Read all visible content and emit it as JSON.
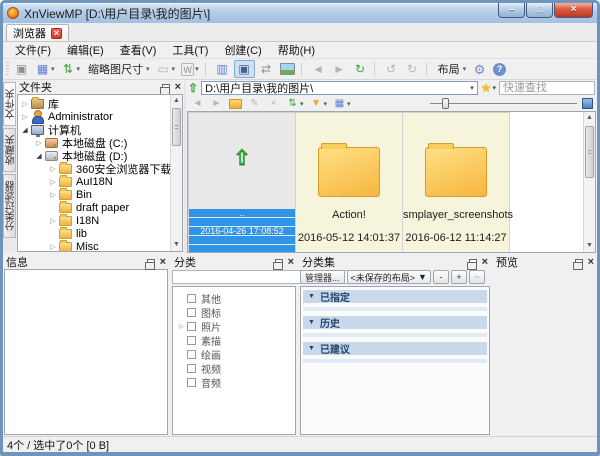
{
  "window": {
    "title": "XnViewMP [D:\\用户目录\\我的图片\\]"
  },
  "window_buttons": [
    {
      "name": "minimize-button",
      "glyph": "–",
      "cls": "wmin"
    },
    {
      "name": "maximize-button",
      "glyph": "□",
      "cls": "wmax"
    },
    {
      "name": "close-button",
      "glyph": "×",
      "cls": "wclose"
    }
  ],
  "tab": {
    "label": "浏览器",
    "close_glyph": "×"
  },
  "menu": {
    "items": [
      {
        "label": "文件(F)"
      },
      {
        "label": "编辑(E)"
      },
      {
        "label": "查看(V)"
      },
      {
        "label": "工具(T)"
      },
      {
        "label": "创建(C)"
      },
      {
        "label": "帮助(H)"
      }
    ]
  },
  "main_toolbar": {
    "items": [
      {
        "name": "viewer-button",
        "glyph": "▣",
        "cls": "c-grey"
      },
      {
        "name": "thumbnail-view-button",
        "glyph": "▦",
        "cls": "c-blue",
        "caret": "▾"
      },
      {
        "name": "sort-button",
        "glyph": "⇅",
        "cls": "c-green",
        "caret": "▾"
      },
      {
        "name": "thumbnail-size-button",
        "label": "缩略图尺寸",
        "cls": "txt",
        "caret": "▾"
      },
      {
        "name": "slideshow-button",
        "glyph": "▭",
        "cls": "c-disabled",
        "caret": "▾"
      },
      {
        "name": "web-button",
        "glyph": "W",
        "cls": "c-grey boxed",
        "caret": "▾"
      },
      {
        "name": "separator",
        "cls": "sep"
      },
      {
        "name": "compare-button",
        "glyph": "▥",
        "cls": "c-blue"
      },
      {
        "name": "capture-button",
        "glyph": "▣",
        "cls": "hl"
      },
      {
        "name": "batch-convert-button",
        "glyph": "⇄",
        "cls": "c-grey"
      },
      {
        "name": "photos-button",
        "glyph": "",
        "cls": "pic"
      },
      {
        "name": "separator",
        "cls": "sep"
      },
      {
        "name": "back-button",
        "glyph": "◄",
        "cls": "c-disabled"
      },
      {
        "name": "forward-button",
        "glyph": "►",
        "cls": "c-disabled"
      },
      {
        "name": "refresh-button",
        "glyph": "↻",
        "cls": "c-green"
      },
      {
        "name": "separator",
        "cls": "sep"
      },
      {
        "name": "rotate-left-button",
        "glyph": "↺",
        "cls": "c-disabled"
      },
      {
        "name": "rotate-right-button",
        "glyph": "↻",
        "cls": "c-disabled"
      },
      {
        "name": "separator",
        "cls": "sep"
      },
      {
        "name": "layout-button",
        "label": "布局",
        "cls": "txt",
        "caret": "▾"
      },
      {
        "name": "settings-button",
        "glyph": "⚙",
        "cls": "c-gear"
      },
      {
        "name": "help-button",
        "glyph": "?",
        "cls": "help"
      }
    ]
  },
  "side_tabs": {
    "items": [
      {
        "label": "文件夹",
        "cls": "active"
      },
      {
        "label": "收藏夹",
        "cls": ""
      },
      {
        "label": "分类过滤器",
        "cls": ""
      }
    ]
  },
  "folders_panel": {
    "title": "文件夹",
    "tree": [
      {
        "label": "库",
        "cls": "d0",
        "arrow": "▷",
        "icon": "i-lib"
      },
      {
        "label": "Administrator",
        "cls": "d0",
        "arrow": "▷",
        "icon": "i-user"
      },
      {
        "label": "计算机",
        "cls": "d0 exp",
        "arrow": "◢",
        "icon": "i-pc"
      },
      {
        "label": "本地磁盘 (C:)",
        "cls": "d1",
        "arrow": "▷",
        "icon": "i-cdrive"
      },
      {
        "label": "本地磁盘 (D:)",
        "cls": "d1 exp",
        "arrow": "◢",
        "icon": "i-drive"
      },
      {
        "label": "360安全浏览器下载",
        "cls": "d2",
        "arrow": "▷",
        "icon": "i-folder"
      },
      {
        "label": "AuI18N",
        "cls": "d2",
        "arrow": "▷",
        "icon": "i-folder"
      },
      {
        "label": "Bin",
        "cls": "d2",
        "arrow": "▷",
        "icon": "i-folder"
      },
      {
        "label": "draft paper",
        "cls": "d2",
        "arrow": "",
        "icon": "i-folder"
      },
      {
        "label": "I18N",
        "cls": "d2",
        "arrow": "▷",
        "icon": "i-folder"
      },
      {
        "label": "lib",
        "cls": "d2",
        "arrow": "",
        "icon": "i-folder"
      },
      {
        "label": "Misc",
        "cls": "d2",
        "arrow": "▷",
        "icon": "i-folder"
      }
    ]
  },
  "address": {
    "up_glyph": "⇧",
    "path": "D:\\用户目录\\我的图片\\",
    "combo_caret": "▾",
    "star_glyph": "★",
    "star_caret": "▾",
    "search_placeholder": "快速查找"
  },
  "browser_toolbar": {
    "items": [
      {
        "name": "back-button",
        "glyph": "◄",
        "cls": "c-disabled"
      },
      {
        "name": "forward-button",
        "glyph": "►",
        "cls": "c-disabled"
      },
      {
        "name": "parent-folder-button",
        "glyph": "",
        "cls": "fup"
      },
      {
        "name": "edit-button",
        "glyph": "✎",
        "cls": "c-disabled"
      },
      {
        "name": "delete-button",
        "glyph": "×",
        "cls": "c-disabled"
      },
      {
        "name": "sort-button",
        "glyph": "⇅",
        "cls": "c-green",
        "caret": "▾"
      },
      {
        "name": "filter-button",
        "glyph": "▼",
        "cls": "c-gold",
        "caret": "▾"
      },
      {
        "name": "view-mode-button",
        "glyph": "▦",
        "cls": "c-blue",
        "caret": "▾"
      }
    ]
  },
  "browser_items": [
    {
      "name": "..",
      "date": "2016-04-26 17:08:52",
      "cls": "up sel",
      "glyph": "⇧"
    },
    {
      "name": "Action!",
      "date": "2016-05-12 14:01:37",
      "cls": "folder",
      "glyph": ""
    },
    {
      "name": "smplayer_screenshots",
      "date": "2016-06-12 11:14:27",
      "cls": "folder",
      "glyph": ""
    }
  ],
  "panels": {
    "info": {
      "title": "信息"
    },
    "category": {
      "title": "分类",
      "more_button": "…",
      "items": [
        {
          "label": "其他",
          "arrow": ""
        },
        {
          "label": "图标",
          "arrow": ""
        },
        {
          "label": "照片",
          "arrow": "▷"
        },
        {
          "label": "素描",
          "arrow": ""
        },
        {
          "label": "绘画",
          "arrow": ""
        },
        {
          "label": "视频",
          "arrow": ""
        },
        {
          "label": "音频",
          "arrow": ""
        }
      ]
    },
    "category_sets": {
      "title": "分类集",
      "manager_button": "管理器...",
      "layout_combo": "<未保存的布局>",
      "minus_button": "-",
      "plus_button": "+",
      "extra_button": "~",
      "sections": [
        {
          "label": "已指定",
          "arrow": "▼"
        },
        {
          "label": "历史",
          "arrow": "▼"
        },
        {
          "label": "已建议",
          "arrow": "▼"
        }
      ]
    },
    "preview": {
      "title": "预览"
    }
  },
  "statusbar": {
    "text": "4个 / 选中了0个 [0 B]"
  },
  "colors": {
    "selection_blue": "#2f93e8",
    "folder_yellow": "#f6b63e",
    "cell_bg": "#f7f4dc",
    "titlebar_blue": "#a9c6e5",
    "section_header": "#c9d8ea"
  }
}
